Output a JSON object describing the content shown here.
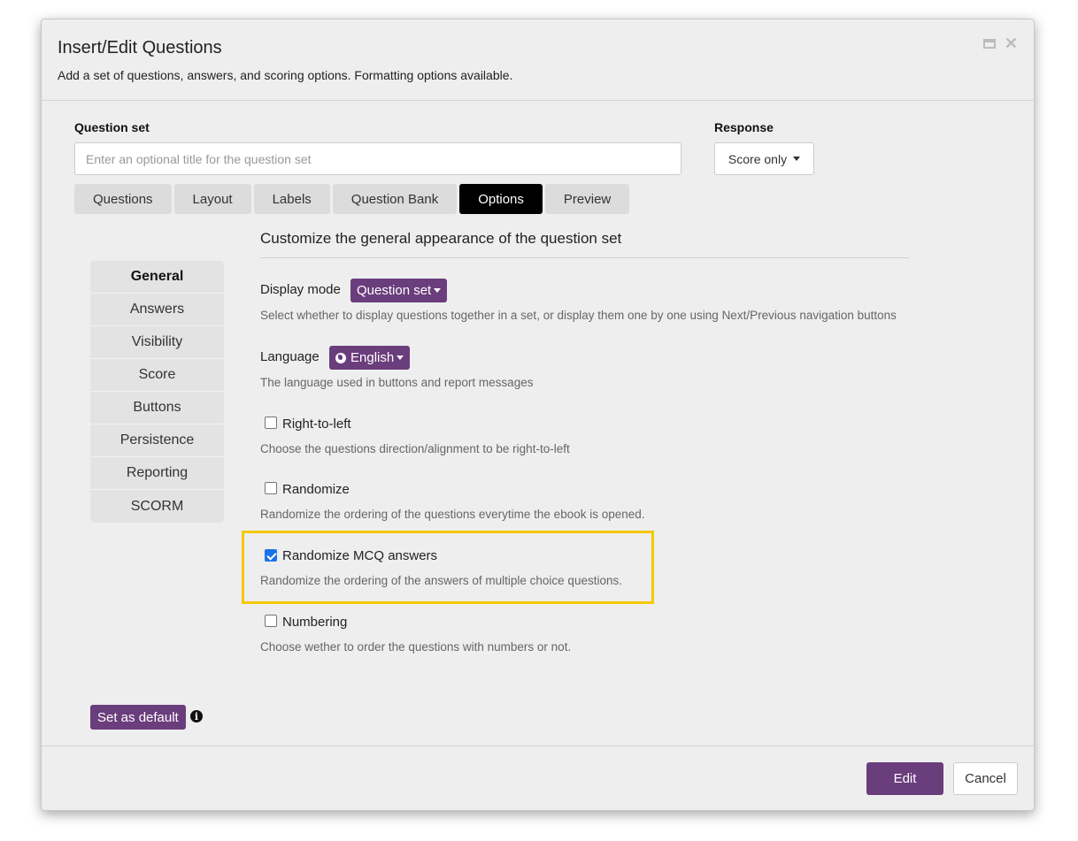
{
  "dialog": {
    "title": "Insert/Edit Questions",
    "subtitle": "Add a set of questions, answers, and scoring options. Formatting options available."
  },
  "question_set": {
    "label": "Question set",
    "placeholder": "Enter an optional title for the question set",
    "value": ""
  },
  "response": {
    "label": "Response",
    "selected": "Score only"
  },
  "tabs": [
    {
      "label": "Questions",
      "active": false
    },
    {
      "label": "Layout",
      "active": false
    },
    {
      "label": "Labels",
      "active": false
    },
    {
      "label": "Question Bank",
      "active": false
    },
    {
      "label": "Options",
      "active": true
    },
    {
      "label": "Preview",
      "active": false
    }
  ],
  "side_menu": [
    {
      "label": "General",
      "active": true
    },
    {
      "label": "Answers",
      "active": false
    },
    {
      "label": "Visibility",
      "active": false
    },
    {
      "label": "Score",
      "active": false
    },
    {
      "label": "Buttons",
      "active": false
    },
    {
      "label": "Persistence",
      "active": false
    },
    {
      "label": "Reporting",
      "active": false
    },
    {
      "label": "SCORM",
      "active": false
    }
  ],
  "options": {
    "heading": "Customize the general appearance of the question set",
    "display_mode": {
      "label": "Display mode",
      "value": "Question set",
      "description": "Select whether to display questions together in a set, or display them one by one using Next/Previous navigation buttons"
    },
    "language": {
      "label": "Language",
      "value": "English",
      "description": "The language used in buttons and report messages"
    },
    "right_to_left": {
      "label": "Right-to-left",
      "checked": false,
      "description": "Choose the questions direction/alignment to be right-to-left"
    },
    "randomize": {
      "label": "Randomize",
      "checked": false,
      "description": "Randomize the ordering of the questions everytime the ebook is opened."
    },
    "randomize_mcq": {
      "label": "Randomize MCQ answers",
      "checked": true,
      "description": "Randomize the ordering of the answers of multiple choice questions."
    },
    "numbering": {
      "label": "Numbering",
      "checked": false,
      "description": "Choose wether to order the questions with numbers or not."
    }
  },
  "footer": {
    "set_default_label": "Set as default",
    "info_glyph": "i",
    "edit_label": "Edit",
    "cancel_label": "Cancel"
  },
  "colors": {
    "accent_purple": "#6a3d7c",
    "active_tab": "#000000",
    "highlight": "#f5c800",
    "checkbox_checked": "#1a73e8"
  },
  "icons": [
    "maximize-icon",
    "close-icon",
    "caret-down-icon",
    "globe-icon",
    "info-icon",
    "checkbox-check-icon"
  ]
}
